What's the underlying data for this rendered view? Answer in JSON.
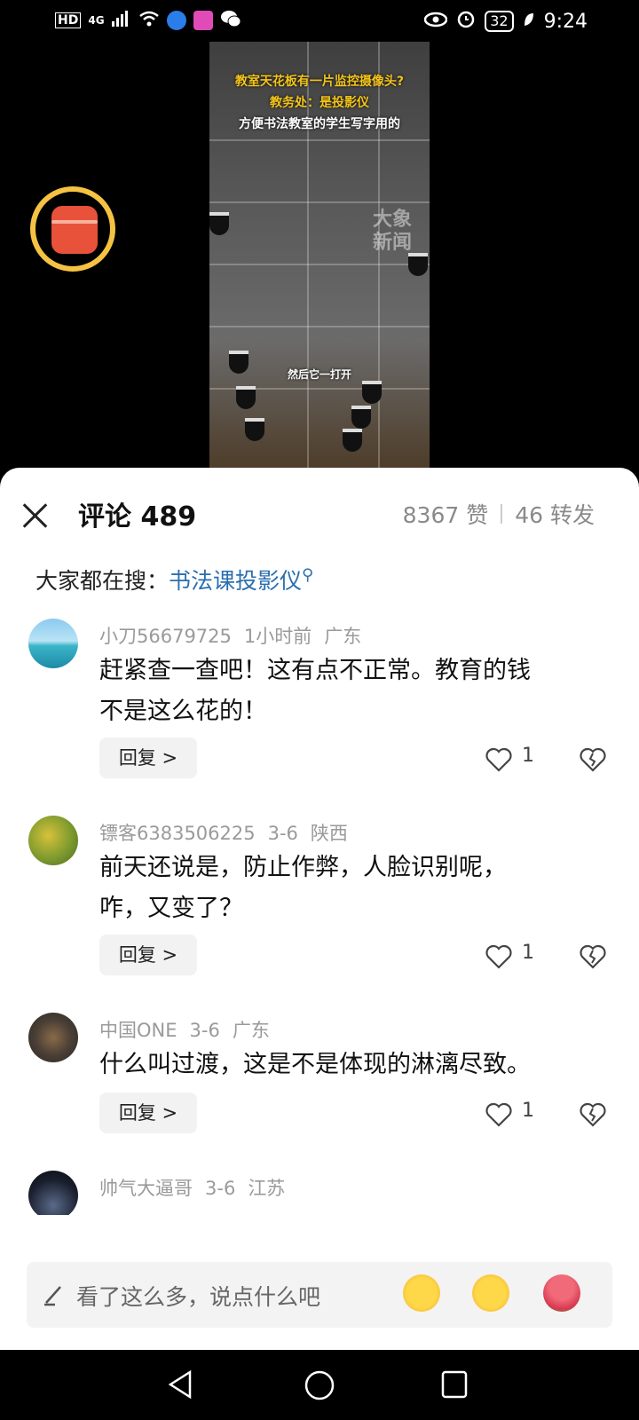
{
  "status_bar": {
    "network_hd": "HD",
    "network_gen": "4G",
    "battery": "32",
    "time": "9:24"
  },
  "video": {
    "caption_line1": "教室天花板有一片监控摄像头?",
    "caption_line2": "教务处：是投影仪",
    "caption_line3": "方便书法教室的学生写字用的",
    "watermark": "大象新闻",
    "subtitle": "然后它一打开"
  },
  "sheet": {
    "title": "评论 489",
    "likes": "8367 赞",
    "shares": "46 转发",
    "hot_search_label": "大家都在搜：",
    "hot_search_term": "书法课投影仪"
  },
  "comments": [
    {
      "user": "小刀56679725",
      "time": "1小时前",
      "location": "广东",
      "text_line1": "赶紧查一查吧！这有点不正常。教育的钱",
      "text_line2": "不是这么花的！",
      "reply": "回复 >",
      "likes": "1"
    },
    {
      "user": "镖客6383506225",
      "time": "3-6",
      "location": "陕西",
      "text_line1": "前天还说是，防止作弊，人脸识别呢，",
      "text_line2": "咋，又变了？",
      "reply": "回复 >",
      "likes": "1"
    },
    {
      "user": "中国ONE",
      "time": "3-6",
      "location": "广东",
      "text_line1": "什么叫过渡，这是不是体现的淋漓尽致。",
      "reply": "回复 >",
      "likes": "1"
    },
    {
      "user": "帅气大逼哥",
      "time": "3-6",
      "location": "江苏"
    }
  ],
  "input": {
    "placeholder": "看了这么多，说点什么吧"
  },
  "colors": {
    "link": "#2a6fb0",
    "caption_yellow": "#f3c419",
    "redpacket": "#e8513a",
    "ring": "#f5c242"
  }
}
